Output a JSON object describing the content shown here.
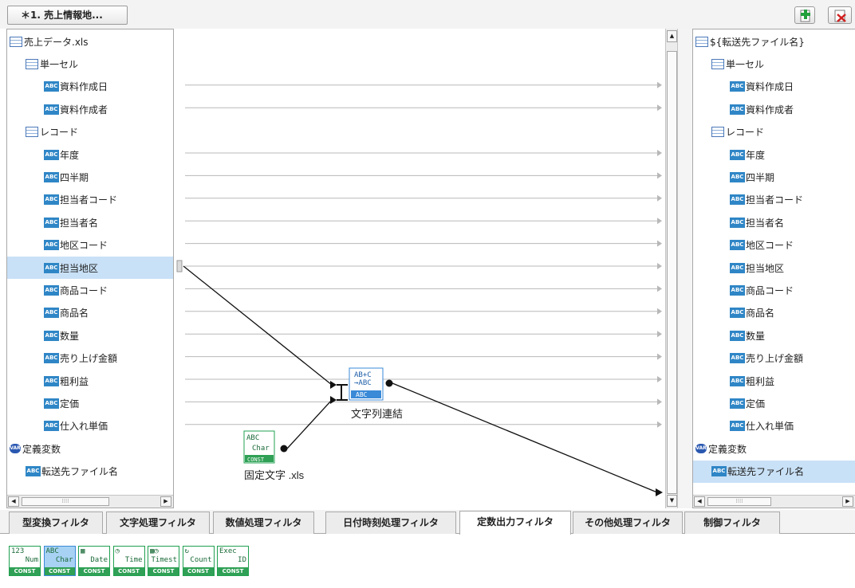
{
  "document_tab": "＊1. 売上情報地...",
  "toolbar": {
    "add_icon": "add-document-icon",
    "delete_icon": "delete-document-icon"
  },
  "left_tree": {
    "root": "売上データ.xls",
    "group1": "単一セル",
    "group1_items": [
      "資料作成日",
      "資料作成者"
    ],
    "group2": "レコード",
    "group2_items": [
      "年度",
      "四半期",
      "担当者コード",
      "担当者名",
      "地区コード",
      "担当地区",
      "商品コード",
      "商品名",
      "数量",
      "売り上げ金額",
      "粗利益",
      "定価",
      "仕入れ単価"
    ],
    "selected_item": "担当地区",
    "var_group": "定義変数",
    "var_items": [
      "転送先ファイル名"
    ]
  },
  "right_tree": {
    "root": "${転送先ファイル名}",
    "group1": "単一セル",
    "group1_items": [
      "資料作成日",
      "資料作成者"
    ],
    "group2": "レコード",
    "group2_items": [
      "年度",
      "四半期",
      "担当者コード",
      "担当者名",
      "地区コード",
      "担当地区",
      "商品コード",
      "商品名",
      "数量",
      "売り上げ金額",
      "粗利益",
      "定価",
      "仕入れ単価"
    ],
    "var_group": "定義変数",
    "var_items": [
      "転送先ファイル名"
    ],
    "selected_item": "転送先ファイル名"
  },
  "canvas": {
    "concat_node_icon_lines": [
      "AB+C",
      "→ABC",
      "ABC"
    ],
    "concat_node_label": "文字列連結",
    "const_node_icon_lines": [
      "ABC",
      "Char",
      "CONST"
    ],
    "const_node_label": "固定文字 .xls"
  },
  "filter_tabs": [
    "型変換フィルタ",
    "文字処理フィルタ",
    "数値処理フィルタ",
    "日付時刻処理フィルタ",
    "定数出力フィルタ",
    "その他処理フィルタ",
    "制御フィルタ"
  ],
  "active_filter_tab": "定数出力フィルタ",
  "palette": [
    {
      "top": "123",
      "mid": "Num",
      "const": "CONST"
    },
    {
      "top": "ABC",
      "mid": "Char",
      "const": "CONST"
    },
    {
      "top": "▦",
      "mid": "Date",
      "const": "CONST"
    },
    {
      "top": "◷",
      "mid": "Time",
      "const": "CONST"
    },
    {
      "top": "▦◷",
      "mid": "Timest",
      "const": "CONST"
    },
    {
      "top": "↻",
      "mid": "Count",
      "const": "CONST"
    },
    {
      "top": "Exec",
      "mid": "ID",
      "const": "CONST"
    }
  ],
  "icon_text": {
    "abc": "ABC",
    "var": "VAR"
  },
  "colors": {
    "selection": "#c9e1f7",
    "abc_icon": "#2f86c6",
    "const_green": "#2fa055"
  }
}
